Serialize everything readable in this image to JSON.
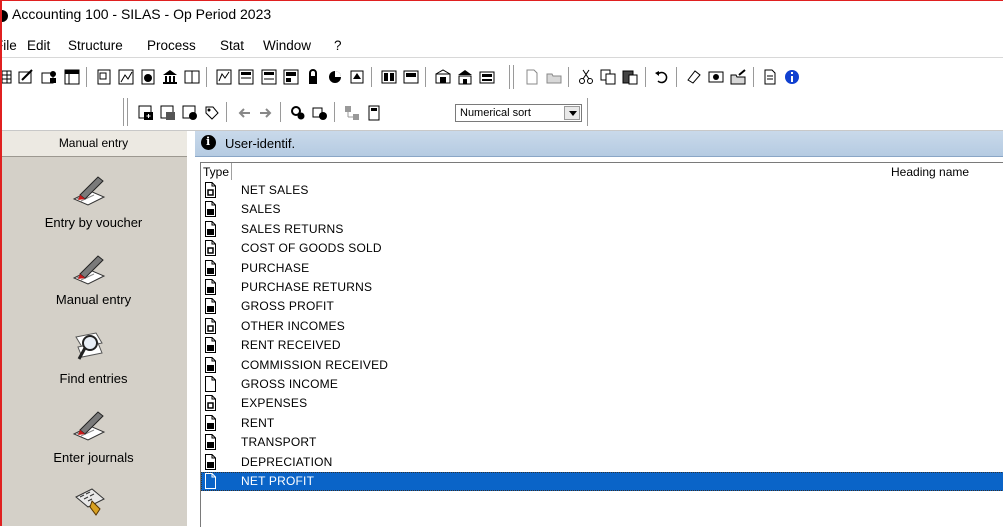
{
  "window": {
    "title": "Accounting 100 - SILAS - Op Period 2023"
  },
  "menu": [
    "File",
    "Edit",
    "Structure",
    "Process",
    "Stat",
    "Window",
    "?"
  ],
  "toolbar2": {
    "sort_select_value": "Numerical sort"
  },
  "left_panel": {
    "header": "Manual entry",
    "shortcuts": [
      {
        "label": "Entry by voucher",
        "icon": "pen-notepad-icon"
      },
      {
        "label": "Manual entry",
        "icon": "pen-notepad-icon"
      },
      {
        "label": "Find entries",
        "icon": "magnifier-icon"
      },
      {
        "label": "Enter journals",
        "icon": "pen-notepad-icon"
      },
      {
        "label": "",
        "icon": "calculator-icon"
      }
    ]
  },
  "right_panel": {
    "title": "User-identif.",
    "columns": {
      "type": "Type",
      "heading_name": "Heading name"
    },
    "rows": [
      {
        "name": "NET SALES",
        "type": "empty"
      },
      {
        "name": "SALES",
        "type": "filled"
      },
      {
        "name": "SALES RETURNS",
        "type": "filled"
      },
      {
        "name": "COST OF GOODS SOLD",
        "type": "empty"
      },
      {
        "name": "PURCHASE",
        "type": "filled"
      },
      {
        "name": "PURCHASE RETURNS",
        "type": "filled"
      },
      {
        "name": "GROSS PROFIT",
        "type": "filled"
      },
      {
        "name": "OTHER INCOMES",
        "type": "empty"
      },
      {
        "name": "RENT RECEIVED",
        "type": "filled"
      },
      {
        "name": "COMMISSION RECEIVED",
        "type": "filled"
      },
      {
        "name": "GROSS INCOME",
        "type": "plain"
      },
      {
        "name": "EXPENSES",
        "type": "empty"
      },
      {
        "name": "RENT",
        "type": "filled"
      },
      {
        "name": "TRANSPORT",
        "type": "filled"
      },
      {
        "name": "DEPRECIATION",
        "type": "filled"
      },
      {
        "name": "NET PROFIT",
        "type": "plain",
        "selected": true
      }
    ]
  },
  "colors": {
    "selection": "#0a64c8",
    "panel_bg": "#d4d0c8",
    "title_bar_blue": "#b5cbe2"
  }
}
